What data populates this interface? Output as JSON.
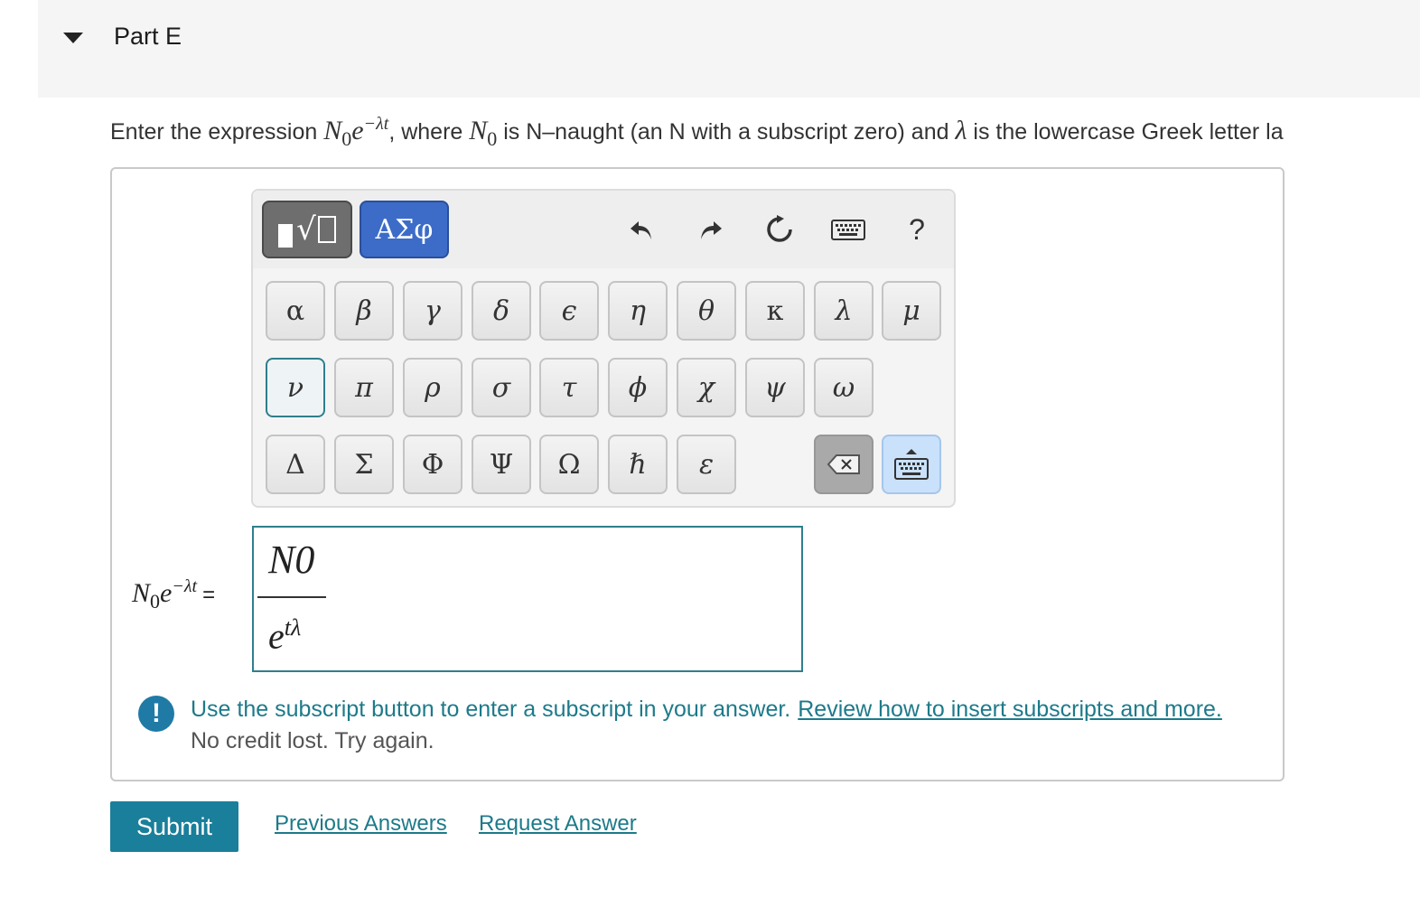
{
  "part": {
    "title": "Part E"
  },
  "instruction": {
    "lead": "Enter the expression ",
    "expr_N": "N",
    "expr_sub": "0",
    "expr_e": "e",
    "expr_sup": "−λt",
    "mid1": ", where ",
    "n_var": "N",
    "n_sub": "0",
    "mid2": " is N–naught (an N with a subscript zero) and ",
    "lambda": "λ",
    "tail": " is the lowercase Greek letter la"
  },
  "palette": {
    "greek_mode_label": "ΑΣφ",
    "help_label": "?",
    "row1": [
      "α",
      "β",
      "γ",
      "δ",
      "ϵ",
      "η",
      "θ",
      "κ",
      "λ",
      "μ"
    ],
    "row2": [
      "ν",
      "π",
      "ρ",
      "σ",
      "τ",
      "ϕ",
      "χ",
      "ψ",
      "ω"
    ],
    "row3": [
      "Δ",
      "Σ",
      "Φ",
      "Ψ",
      "Ω",
      "ℏ",
      "ε"
    ]
  },
  "answer": {
    "label_N": "N",
    "label_sub": "0",
    "label_e": "e",
    "label_sup": "−λt",
    "label_eq": "=",
    "numerator": "N0",
    "denominator_base": "e",
    "denominator_sup": "tλ"
  },
  "feedback": {
    "message": "Use the subscript button to enter a subscript in your answer.",
    "link": "Review how to insert subscripts and more.",
    "sub": "No credit lost. Try again."
  },
  "actions": {
    "submit": "Submit",
    "previous": "Previous Answers",
    "request": "Request Answer"
  },
  "colors": {
    "accent": "#1a7f9a",
    "greek_mode": "#3c6cc8",
    "focus": "#2f7f8c",
    "info": "#1f7aa6"
  }
}
